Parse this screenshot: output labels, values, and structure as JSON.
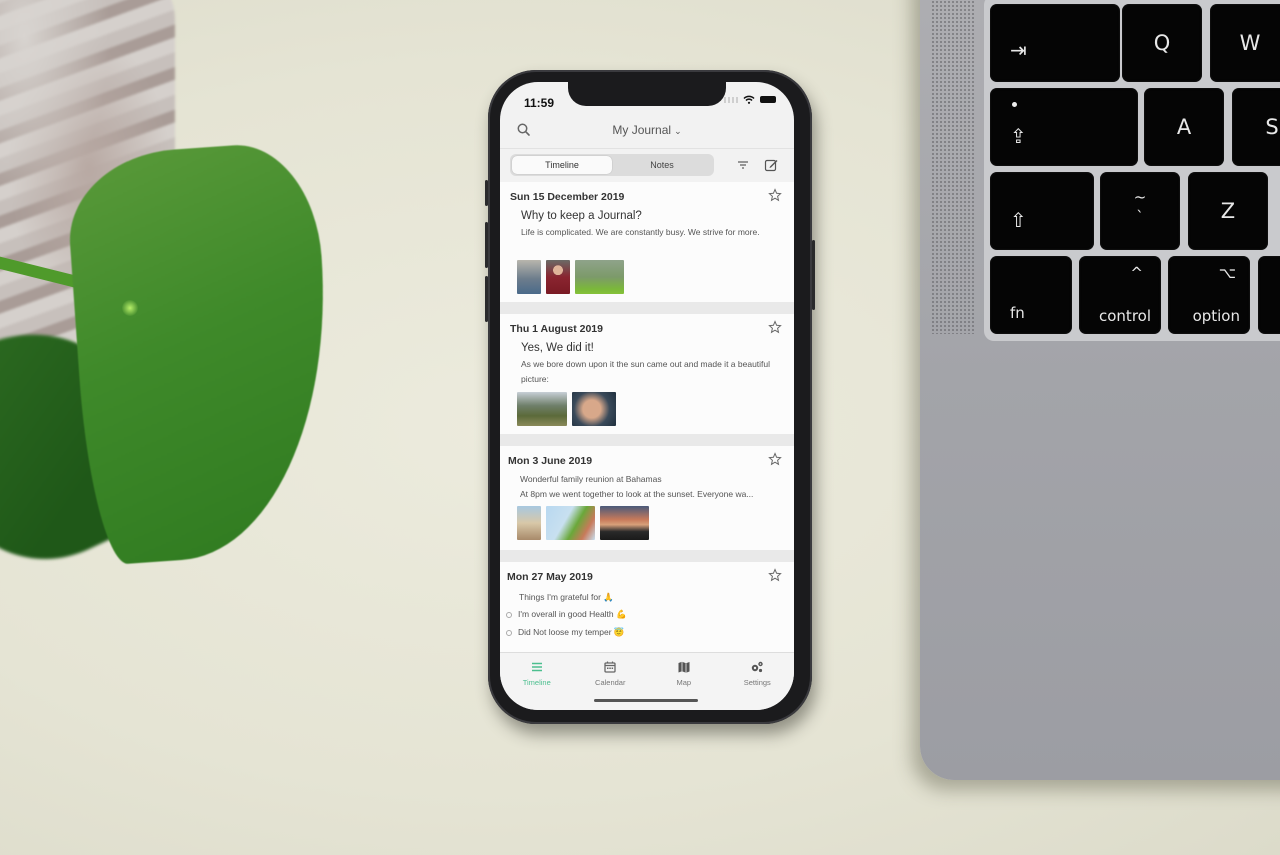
{
  "scene": {
    "keyboard": {
      "keys": [
        {
          "name": "tab",
          "label": "⇥"
        },
        {
          "name": "q",
          "label": "Q"
        },
        {
          "name": "w",
          "label": "W"
        },
        {
          "name": "caps-lock",
          "label": "⇪"
        },
        {
          "name": "a",
          "label": "A"
        },
        {
          "name": "s",
          "label": "S"
        },
        {
          "name": "shift",
          "label": "⇧"
        },
        {
          "name": "backtick",
          "label_top": "~",
          "label_bottom": "`"
        },
        {
          "name": "z",
          "label": "Z"
        },
        {
          "name": "fn",
          "label": "fn"
        },
        {
          "name": "control",
          "label": "control",
          "symbol": "^"
        },
        {
          "name": "option",
          "label": "option",
          "symbol": "⌥"
        }
      ]
    }
  },
  "phone": {
    "status_bar": {
      "time": "11:59"
    },
    "nav": {
      "title": "My Journal",
      "chevron": "⌄"
    },
    "segmented": {
      "tabs": [
        {
          "label": "Timeline",
          "active": true
        },
        {
          "label": "Notes",
          "active": false
        }
      ]
    },
    "entries": [
      {
        "date": "Sun 15 December 2019",
        "title": "Why to keep a Journal?",
        "text": "Life is complicated. We are constantly busy.  We strive for more.",
        "photos": [
          "person-sitting-photo",
          "woman-red-sweater-photo",
          "forest-photo"
        ]
      },
      {
        "date": "Thu 1 August 2019",
        "title": "Yes, We did it!",
        "text": "As we bore down upon it the sun came out and made it a beautiful picture:",
        "photos": [
          "mountain-hiker-photo",
          "child-portrait-photo"
        ]
      },
      {
        "date": "Mon 3 June 2019",
        "line1_prefix": "Wonderful family reunion at ",
        "line1_link": "Bahamas",
        "line2": "At 8pm we went together to look at the sunset. Everyone wa...",
        "photos": [
          "beach-people-photo",
          "palm-tree-photo",
          "sunset-crowd-photo"
        ]
      },
      {
        "date": "Mon 27 May 2019",
        "heading": "Things I'm grateful for 🙏",
        "checklist": [
          "I'm overall in good Health 💪",
          "Did Not loose my temper 😇"
        ]
      }
    ],
    "tab_bar": {
      "tabs": [
        {
          "label": "Timeline",
          "active": true
        },
        {
          "label": "Calendar",
          "active": false
        },
        {
          "label": "Map",
          "active": false
        },
        {
          "label": "Settings",
          "active": false
        }
      ]
    },
    "accent_color": "#4cbf8f"
  }
}
